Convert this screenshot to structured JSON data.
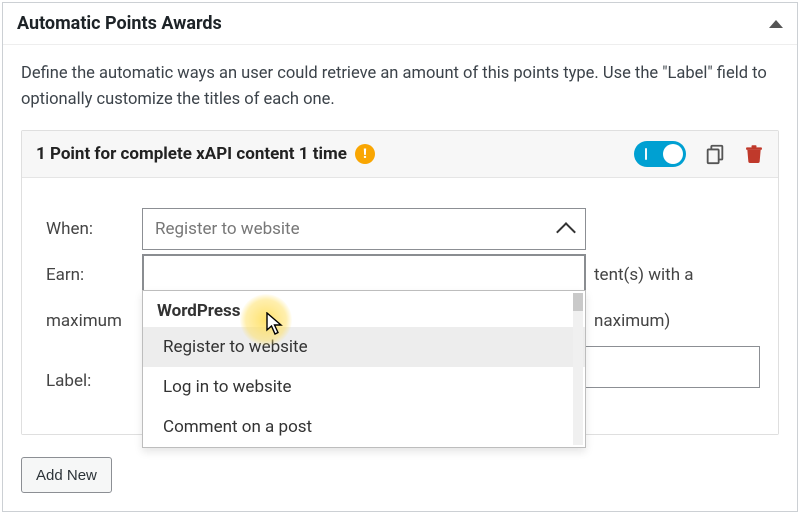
{
  "panel": {
    "title": "Automatic Points Awards"
  },
  "description": "Define the automatic ways an user could retrieve an amount of this points type. Use the \"Label\" field to optionally customize the titles of each one.",
  "rule": {
    "title": "1 Point for complete xAPI content 1 time",
    "toggle_on": true
  },
  "form": {
    "when_label": "When:",
    "earn_label": "Earn:",
    "earn_tail": "tent(s) with a",
    "max_lead": "maximum",
    "max_tail": "naximum)",
    "label_label": "Label:"
  },
  "combo": {
    "placeholder": "Register to website"
  },
  "dropdown": {
    "group": "WordPress",
    "options": [
      "Register to website",
      "Log in to website",
      "Comment on a post"
    ]
  },
  "add_button": "Add New",
  "icons": {
    "warn": "!",
    "copy": "copy-icon",
    "trash": "trash-icon"
  }
}
